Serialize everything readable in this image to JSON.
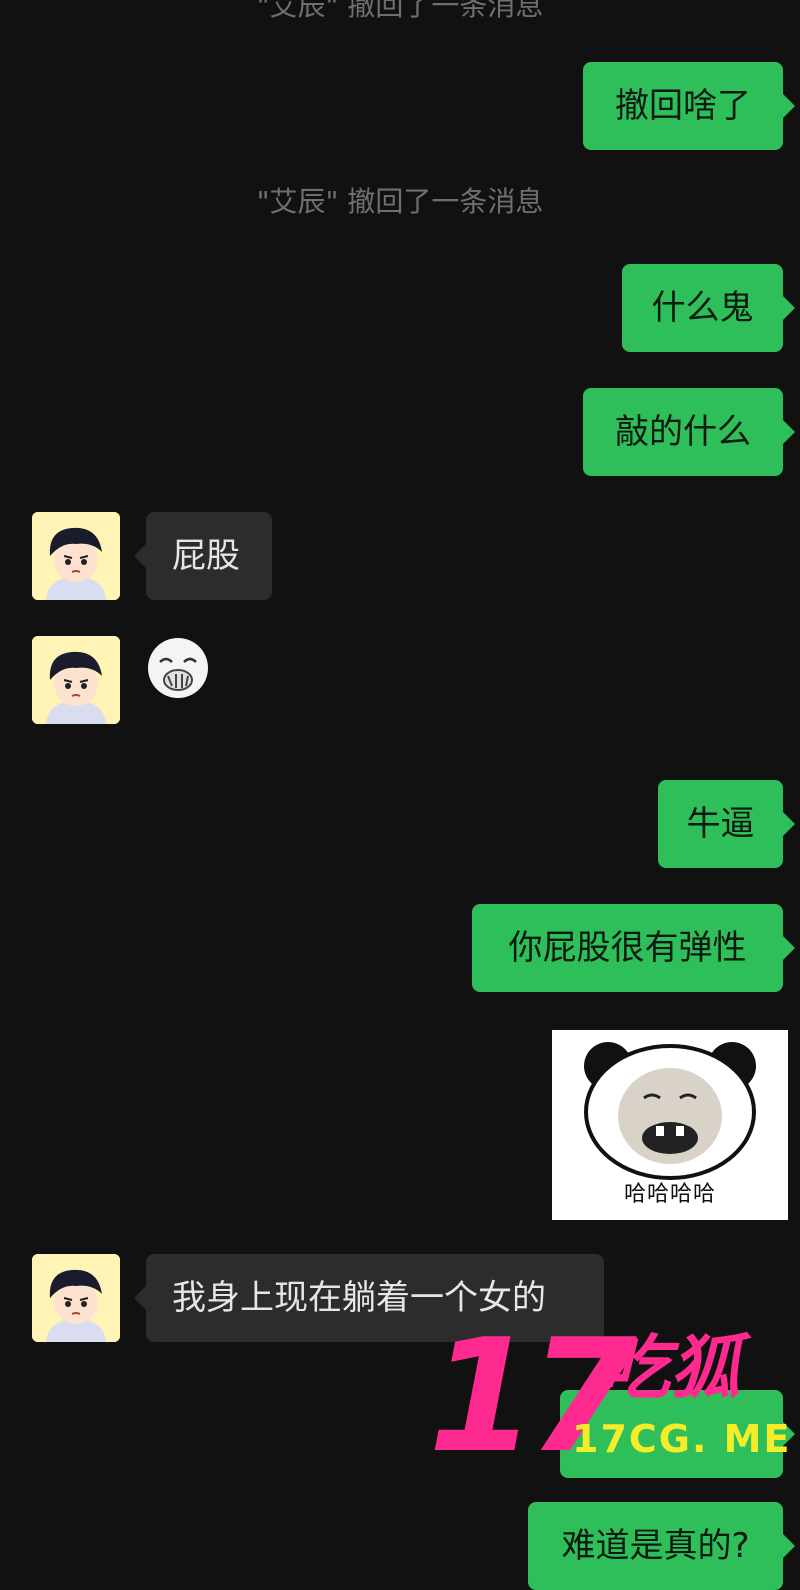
{
  "system_messages": [
    "\"艾辰\" 撤回了一条消息",
    "\"艾辰\" 撤回了一条消息"
  ],
  "messages": [
    {
      "side": "me",
      "text": "撤回啥了"
    },
    {
      "side": "me",
      "text": "什么鬼"
    },
    {
      "side": "me",
      "text": "敲的什么"
    },
    {
      "side": "them",
      "text": "屁股"
    },
    {
      "side": "me",
      "text": "牛逼"
    },
    {
      "side": "me",
      "text": "你屁股很有弹性"
    },
    {
      "side": "them",
      "text": "我身上现在躺着一个女的"
    },
    {
      "side": "me",
      "text": "难道是真的?"
    }
  ],
  "stickers": {
    "panda_caption": "哈哈哈哈"
  },
  "watermark": {
    "big": "17",
    "chinese": "吃狐",
    "url": "17CG. ME"
  },
  "colors": {
    "background": "#111111",
    "my_bubble": "#2fbf5a",
    "their_bubble": "#2c2c2c",
    "system_text": "#6f6f6f",
    "watermark_pink": "#ff2a8f",
    "watermark_yellow": "#f5ec2a"
  }
}
